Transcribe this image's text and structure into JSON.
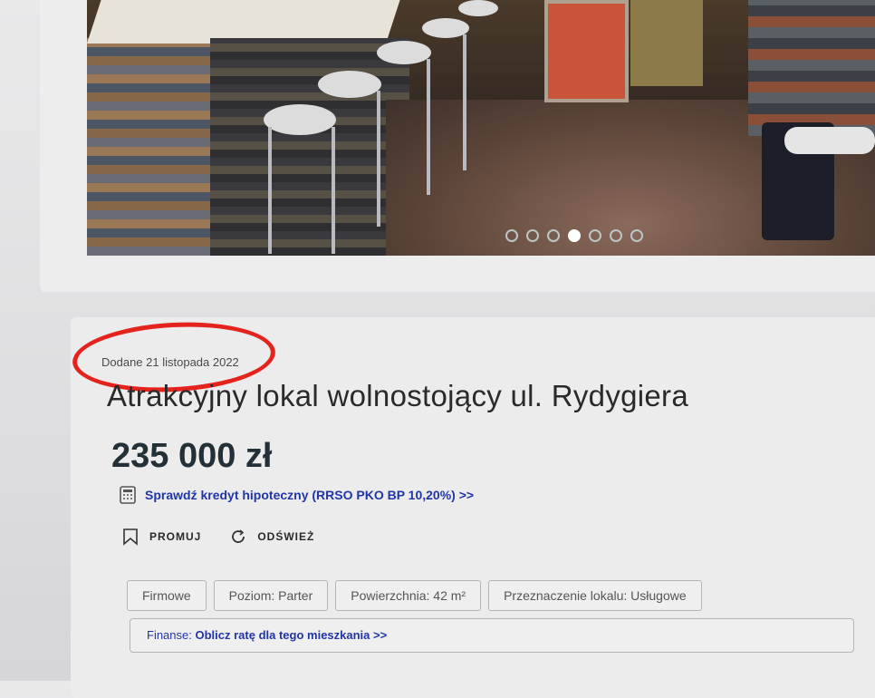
{
  "gallery": {
    "dots_total": 7,
    "active_index": 3
  },
  "listing": {
    "added": "Dodane 21 listopada 2022",
    "title": "Atrakcyjny lokal wolnostojący ul. Rydygiera",
    "price": "235 000 zł",
    "credit_link": "Sprawdź kredyt hipoteczny (RRSO PKO BP 10,20%) >>"
  },
  "actions": {
    "promote": "PROMUJ",
    "refresh": "ODŚWIEŻ"
  },
  "tags": [
    "Firmowe",
    "Poziom: Parter",
    "Powierzchnia: 42 m²",
    "Przeznaczenie lokalu: Usługowe"
  ],
  "finance": {
    "label": "Finanse:",
    "link": "Oblicz ratę dla tego mieszkania >>"
  },
  "colors": {
    "link": "#2036a8",
    "highlight_circle": "#e5231d",
    "price": "#243038"
  },
  "icons": {
    "credit": "calculator-icon",
    "promote": "bookmark-icon",
    "refresh": "refresh-icon"
  }
}
